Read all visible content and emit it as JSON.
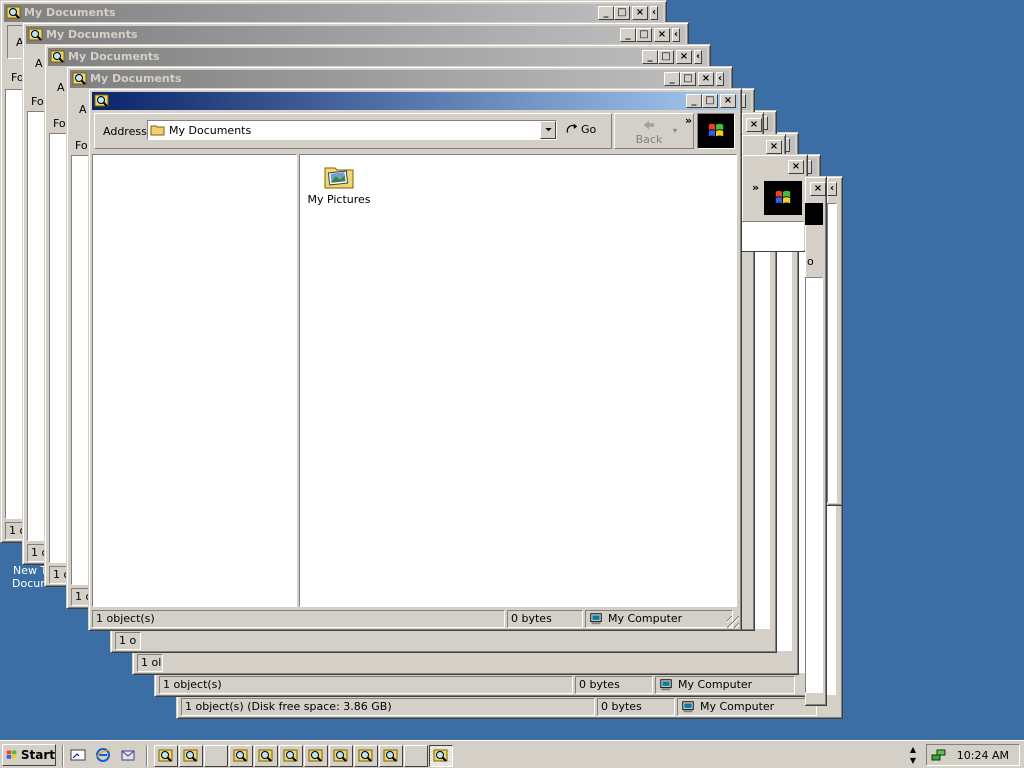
{
  "window_title": "My Documents",
  "address": {
    "label": "Address",
    "value": "My Documents"
  },
  "toolbar": {
    "go_label": "Go",
    "back_label": "Back",
    "chevron": "»",
    "folder_col_partial": "Fo",
    "address_partial": "A"
  },
  "content": {
    "item_label": "My Pictures"
  },
  "status": {
    "objects": "1 object(s)",
    "size": "0 bytes",
    "zone": "My Computer",
    "free_space": "1 object(s) (Disk free space: 3.86 GB)",
    "partial": "1 ol",
    "partial2": "1 o",
    "partial3": "o"
  },
  "desktop": {
    "icon_label_1": "New T",
    "icon_label_2": "Docum"
  },
  "taskbar": {
    "start_label": "Start",
    "clock": "10:24 AM"
  },
  "colors": {
    "desktop": "#3a6ea5",
    "active_title": "#0a246a",
    "inactive_title": "#808080",
    "chrome": "#d4d0c8"
  },
  "icons": {
    "window": "explorer-search-icon",
    "folder": "my-pictures-folder-icon",
    "go": "go-arrow-icon",
    "back": "back-arrow-icon",
    "brand": "windows-logo-icon",
    "zone": "my-computer-icon"
  }
}
